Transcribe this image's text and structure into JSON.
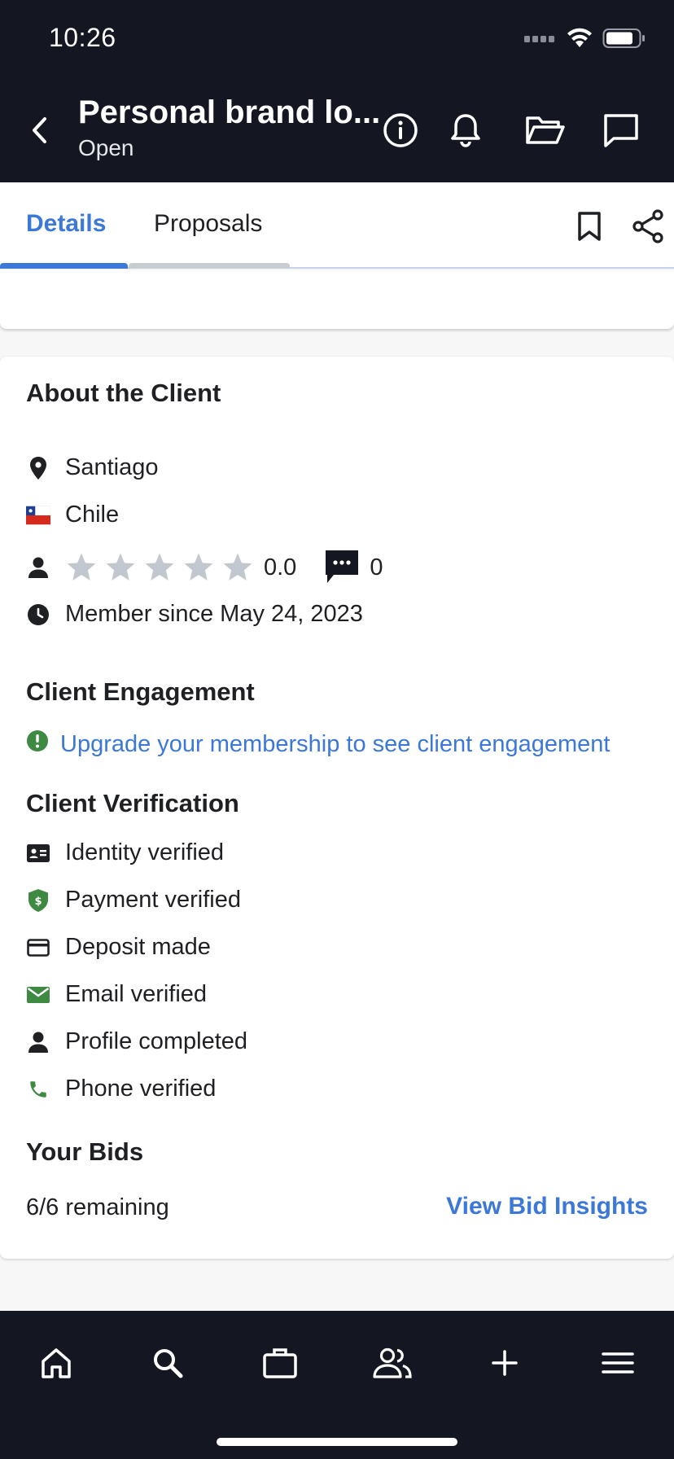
{
  "status_bar": {
    "time": "10:26"
  },
  "header": {
    "title": "Personal brand lo...",
    "status": "Open"
  },
  "tabs": [
    {
      "label": "Details",
      "active": true
    },
    {
      "label": "Proposals",
      "active": false
    }
  ],
  "about_client": {
    "title": "About the Client",
    "city": "Santiago",
    "country": "Chile",
    "rating": "0.0",
    "rating_stars": 0,
    "review_count": "0",
    "member_since": "Member since May 24, 2023"
  },
  "engagement": {
    "title": "Client Engagement",
    "upgrade_text": "Upgrade your membership to see client engagement"
  },
  "verification": {
    "title": "Client Verification",
    "items": [
      {
        "label": "Identity verified",
        "icon": "id-card-icon"
      },
      {
        "label": "Payment verified",
        "icon": "dollar-shield-icon"
      },
      {
        "label": "Deposit made",
        "icon": "credit-card-icon"
      },
      {
        "label": "Email verified",
        "icon": "envelope-icon"
      },
      {
        "label": "Profile completed",
        "icon": "person-icon"
      },
      {
        "label": "Phone verified",
        "icon": "phone-icon"
      }
    ]
  },
  "bids": {
    "title": "Your Bids",
    "remaining": "6/6 remaining",
    "insights_label": "View Bid Insights"
  },
  "colors": {
    "accent": "#3b78d8",
    "dark": "#141722",
    "verified_green": "#3e8a43",
    "star_gray": "#c3c8d0"
  },
  "bottom_nav": [
    "home-icon",
    "search-icon",
    "briefcase-icon",
    "users-icon",
    "plus-icon",
    "menu-icon"
  ]
}
